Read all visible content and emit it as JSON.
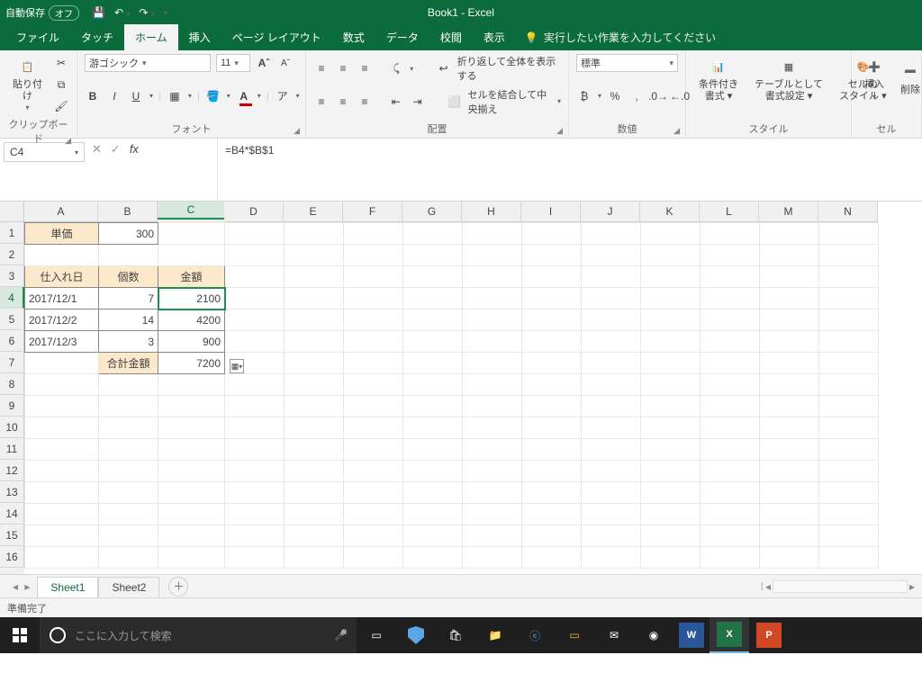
{
  "titlebar": {
    "autosave_label": "自動保存",
    "autosave_state": "オフ",
    "title": "Book1 - Excel"
  },
  "tabs": {
    "file": "ファイル",
    "touch": "タッチ",
    "home": "ホーム",
    "insert": "挿入",
    "layout": "ページ レイアウト",
    "formulas": "数式",
    "data": "データ",
    "review": "校閲",
    "view": "表示",
    "tell": "実行したい作業を入力してください"
  },
  "ribbon": {
    "clipboard": {
      "paste": "貼り付け",
      "label": "クリップボード"
    },
    "font": {
      "name": "游ゴシック",
      "size": "11",
      "label": "フォント"
    },
    "align": {
      "wrap": "折り返して全体を表示する",
      "merge": "セルを結合して中央揃え",
      "label": "配置"
    },
    "number": {
      "format": "標準",
      "label": "数値"
    },
    "styles": {
      "cond": "条件付き\n書式 ▾",
      "table": "テーブルとして\n書式設定 ▾",
      "cell": "セルの\nスタイル ▾",
      "label": "スタイル"
    },
    "cells": {
      "insert": "挿入",
      "delete": "削除",
      "label": "セル"
    }
  },
  "formula": {
    "ref": "C4",
    "value": "=B4*$B$1"
  },
  "columns": [
    "A",
    "B",
    "C",
    "D",
    "E",
    "F",
    "G",
    "H",
    "I",
    "J",
    "K",
    "L",
    "M",
    "N"
  ],
  "rows": [
    "1",
    "2",
    "3",
    "4",
    "5",
    "6",
    "7",
    "8",
    "9",
    "10",
    "11",
    "12",
    "13",
    "14",
    "15",
    "16"
  ],
  "data": {
    "A1": "単価",
    "B1": "300",
    "A3": "仕入れ日",
    "B3": "個数",
    "C3": "金額",
    "A4": "2017/12/1",
    "B4": "7",
    "C4": "2100",
    "A5": "2017/12/2",
    "B5": "14",
    "C5": "4200",
    "A6": "2017/12/3",
    "B6": "3",
    "C6": "900",
    "B7": "合計金額",
    "C7": "7200"
  },
  "sheettabs": {
    "s1": "Sheet1",
    "s2": "Sheet2"
  },
  "status": "準備完了",
  "taskbar": {
    "search_placeholder": "ここに入力して検索"
  }
}
